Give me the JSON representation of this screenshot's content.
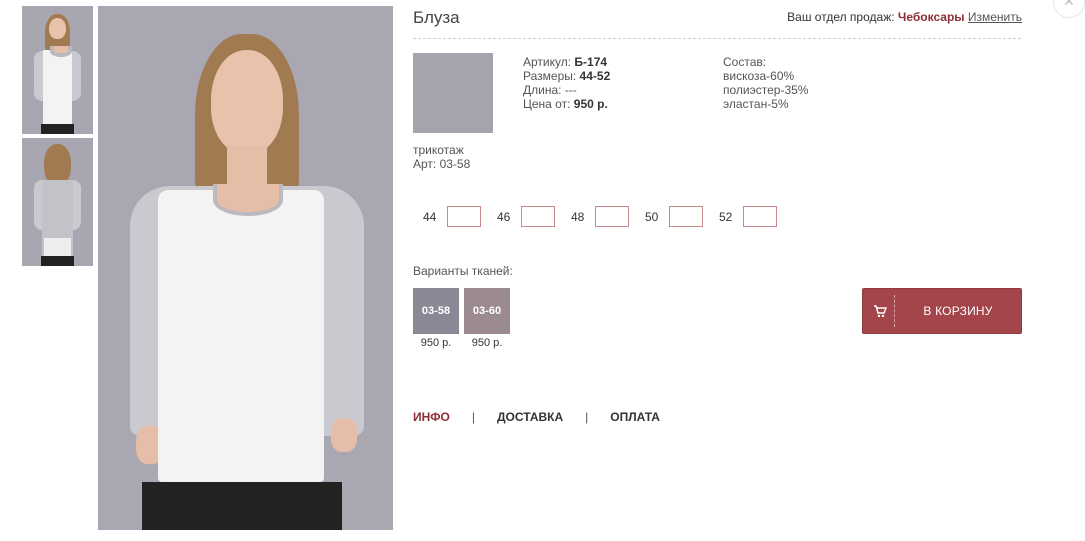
{
  "product": {
    "title": "Блуза",
    "article_label": "Артикул:",
    "article_value": "Б-174",
    "sizes_label": "Размеры:",
    "sizes_value": "44-52",
    "length_label": "Длина:",
    "length_value": "---",
    "price_label": "Цена от:",
    "price_value": "950 р."
  },
  "department": {
    "label": "Ваш отдел продаж:",
    "city": "Чебоксары",
    "change": "Изменить"
  },
  "composition": {
    "label": "Состав:",
    "items": [
      "вискоза-60%",
      "полиэстер-35%",
      "эластан-5%"
    ]
  },
  "fabric": {
    "name": "трикотаж",
    "art": "Арт: 03-58"
  },
  "sizes": [
    "44",
    "46",
    "48",
    "50",
    "52"
  ],
  "variants": {
    "label": "Варианты тканей:",
    "items": [
      {
        "code": "03-58",
        "price": "950 р.",
        "color": "#8a8894"
      },
      {
        "code": "03-60",
        "price": "950 р.",
        "color": "#9b8b8e"
      }
    ]
  },
  "cart": {
    "label": "В КОРЗИНУ",
    "icon": "cart-icon"
  },
  "tabs": [
    "ИНФО",
    "ДОСТАВКА",
    "ОПЛАТА"
  ],
  "colors": {
    "accent": "#8c2f35",
    "button": "#a3454a"
  }
}
